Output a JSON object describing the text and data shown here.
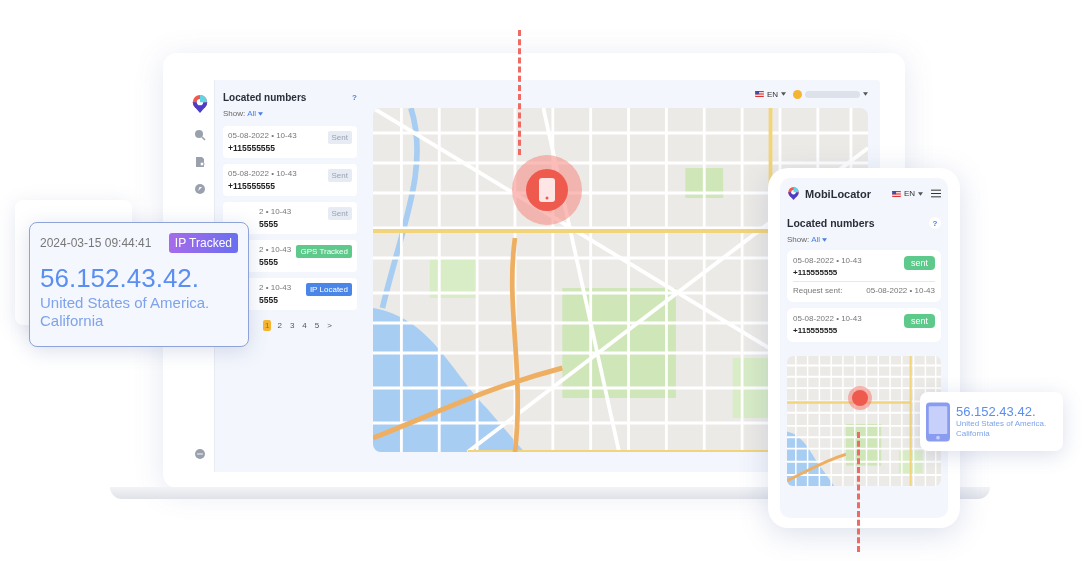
{
  "laptop": {
    "topbar": {
      "language": "EN"
    },
    "list": {
      "title": "Located numbers",
      "help": "?",
      "show_label": "Show:",
      "show_value": "All",
      "items": [
        {
          "date": "05-08-2022 • 10-43",
          "number": "+115555555",
          "status": "Sent",
          "kind": "sent",
          "covered": false
        },
        {
          "date": "05-08-2022 • 10-43",
          "number": "+115555555",
          "status": "Sent",
          "kind": "sent",
          "covered": false
        },
        {
          "date": "2 • 10-43",
          "number": "5555",
          "status": "Sent",
          "kind": "sent",
          "covered": true
        },
        {
          "date": "2 • 10-43",
          "number": "5555",
          "status": "GPS Tracked",
          "kind": "gps",
          "covered": true
        },
        {
          "date": "2 • 10-43",
          "number": "5555",
          "status": "IP Located",
          "kind": "ip",
          "covered": true
        }
      ],
      "pages": [
        {
          "label": "1",
          "selected": true
        },
        {
          "label": "2",
          "selected": false
        },
        {
          "label": "3",
          "selected": false
        },
        {
          "label": "4",
          "selected": false
        },
        {
          "label": "5",
          "selected": false
        },
        {
          "label": ">",
          "selected": false
        }
      ]
    }
  },
  "ip_card": {
    "time": "2024-03-15 09:44:41",
    "badge": "IP Tracked",
    "ip": "56.152.43.42.",
    "location": "United States of America. California"
  },
  "phone": {
    "brand": "MobiLocator",
    "language": "EN",
    "title": "Located numbers",
    "help": "?",
    "show_label": "Show:",
    "show_value": "All",
    "items": [
      {
        "date": "05-08-2022 • 10-43",
        "number": "+115555555",
        "status": "sent",
        "request_label": "Request sent:",
        "request_date": "05-08-2022 • 10-43"
      },
      {
        "date": "05-08-2022 • 10-43",
        "number": "+115555555",
        "status": "sent"
      }
    ]
  },
  "location_card": {
    "ip": "56.152.43.42.",
    "location": "United States of America. California"
  }
}
